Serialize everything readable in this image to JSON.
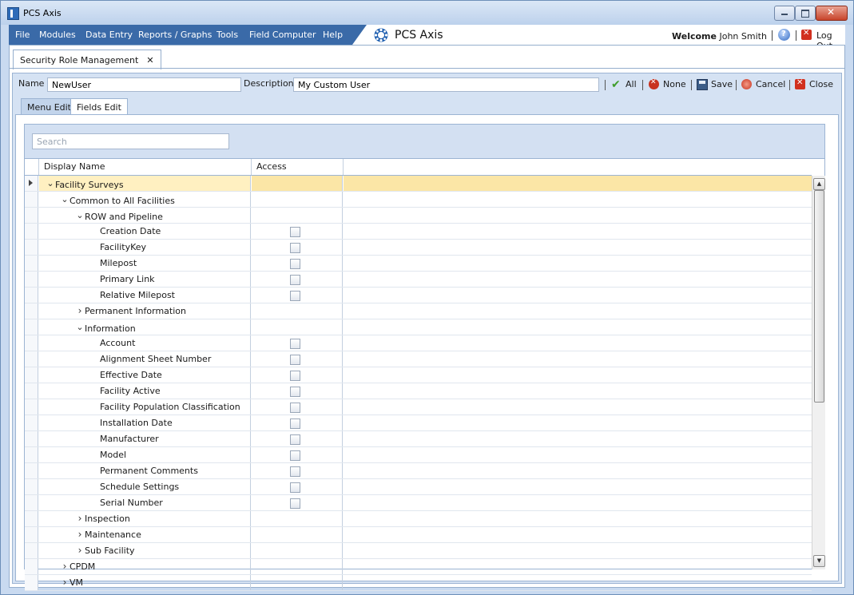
{
  "window": {
    "title": "PCS Axis"
  },
  "menu": {
    "items": [
      "File",
      "Modules",
      "Data Entry",
      "Reports / Graphs",
      "Tools",
      "Field Computer",
      "Help"
    ],
    "brand": "PCS Axis",
    "welcome_label": "Welcome",
    "user_name": "John Smith",
    "logout_label": "Log Out"
  },
  "doc_tab": {
    "label": "Security Role Management"
  },
  "form": {
    "name_label": "Name",
    "name_value": "NewUser",
    "description_label": "Description",
    "description_value": "My Custom User"
  },
  "toolbar": {
    "all": "All",
    "none": "None",
    "save": "Save",
    "cancel": "Cancel",
    "close": "Close"
  },
  "subtabs": {
    "menu_edit": "Menu Edit",
    "fields_edit": "Fields Edit"
  },
  "grid": {
    "search_placeholder": "Search",
    "columns": {
      "display_name": "Display Name",
      "access": "Access"
    },
    "rows": [
      {
        "name": "Facility Surveys",
        "level": 0,
        "expander": "expanded",
        "checkbox": false,
        "selected": true
      },
      {
        "name": "Common to All Facilities",
        "level": 1,
        "expander": "expanded",
        "checkbox": false
      },
      {
        "name": "ROW and Pipeline",
        "level": 2,
        "expander": "expanded",
        "checkbox": false
      },
      {
        "name": "Creation Date",
        "level": 3,
        "expander": "none",
        "checkbox": true
      },
      {
        "name": "FacilityKey",
        "level": 3,
        "expander": "none",
        "checkbox": true
      },
      {
        "name": "Milepost",
        "level": 3,
        "expander": "none",
        "checkbox": true
      },
      {
        "name": "Primary Link",
        "level": 3,
        "expander": "none",
        "checkbox": true
      },
      {
        "name": "Relative Milepost",
        "level": 3,
        "expander": "none",
        "checkbox": true
      },
      {
        "name": "Permanent Information",
        "level": 2,
        "expander": "collapsed",
        "checkbox": false
      },
      {
        "name": "Information",
        "level": 2,
        "expander": "expanded",
        "checkbox": false
      },
      {
        "name": "Account",
        "level": 3,
        "expander": "none",
        "checkbox": true
      },
      {
        "name": "Alignment Sheet Number",
        "level": 3,
        "expander": "none",
        "checkbox": true
      },
      {
        "name": "Effective Date",
        "level": 3,
        "expander": "none",
        "checkbox": true
      },
      {
        "name": "Facility Active",
        "level": 3,
        "expander": "none",
        "checkbox": true
      },
      {
        "name": "Facility Population Classification",
        "level": 3,
        "expander": "none",
        "checkbox": true
      },
      {
        "name": "Installation Date",
        "level": 3,
        "expander": "none",
        "checkbox": true
      },
      {
        "name": "Manufacturer",
        "level": 3,
        "expander": "none",
        "checkbox": true
      },
      {
        "name": "Model",
        "level": 3,
        "expander": "none",
        "checkbox": true
      },
      {
        "name": "Permanent Comments",
        "level": 3,
        "expander": "none",
        "checkbox": true
      },
      {
        "name": "Schedule Settings",
        "level": 3,
        "expander": "none",
        "checkbox": true
      },
      {
        "name": "Serial Number",
        "level": 3,
        "expander": "none",
        "checkbox": true
      },
      {
        "name": "Inspection",
        "level": 2,
        "expander": "collapsed",
        "checkbox": false
      },
      {
        "name": "Maintenance",
        "level": 2,
        "expander": "collapsed",
        "checkbox": false
      },
      {
        "name": "Sub Facility",
        "level": 2,
        "expander": "collapsed",
        "checkbox": false
      },
      {
        "name": "CPDM",
        "level": 1,
        "expander": "collapsed",
        "checkbox": false
      },
      {
        "name": "VM",
        "level": 1,
        "expander": "collapsed",
        "checkbox": false
      }
    ]
  },
  "colors": {
    "menu_bar": "#3a6aa8",
    "selected_row": "#fbe6a6",
    "panel": "#d5e2f3"
  }
}
